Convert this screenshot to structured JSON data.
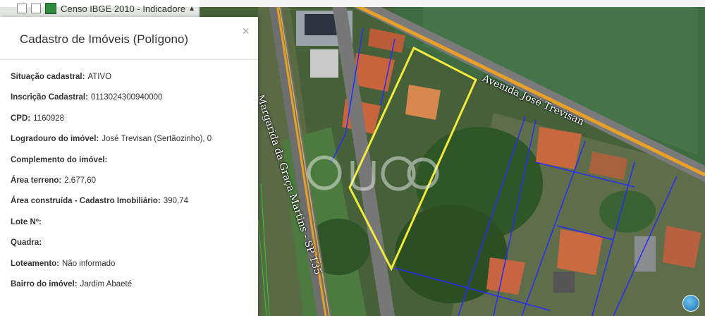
{
  "layer_bar": {
    "label": "Censo IBGE 2010 - Indicadore",
    "caret": "▲"
  },
  "panel": {
    "title": "Cadastro de Imóveis (Polígono)",
    "close": "×",
    "fields": [
      {
        "label": "Situação cadastral:",
        "value": "ATIVO"
      },
      {
        "label": "Inscrição Cadastral:",
        "value": "0113024300940000"
      },
      {
        "label": "CPD:",
        "value": "1160928"
      },
      {
        "label": "Logradouro do imóvel:",
        "value": "José Trevisan (Sertãozinho), 0"
      },
      {
        "label": "Complemento do imóvel:",
        "value": ""
      },
      {
        "label": "Área terreno:",
        "value": "2.677,60"
      },
      {
        "label": "Área construída - Cadastro Imobiliário:",
        "value": "390,74"
      },
      {
        "label": "Lote Nº:",
        "value": ""
      },
      {
        "label": "Quadra:",
        "value": ""
      },
      {
        "label": "Loteamento:",
        "value": "Não informado"
      },
      {
        "label": "Bairro do imóvel:",
        "value": "Jardim Abaeté"
      }
    ]
  },
  "map": {
    "road_labels": {
      "avenida": "Avenida José Trevisan",
      "sp": "Margarida da Graça Martins - SP 135"
    },
    "colors": {
      "highlight": "#f2ea3c",
      "parcel": "#2a2aff",
      "road": "#e8a028"
    }
  }
}
